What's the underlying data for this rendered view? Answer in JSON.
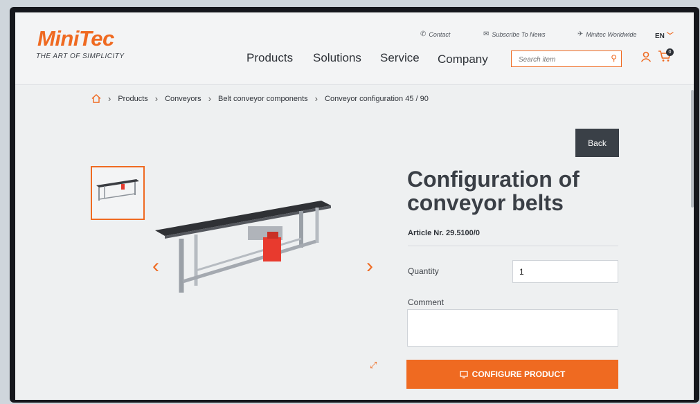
{
  "logo": {
    "name": "MiniTec",
    "tagline": "THE ART OF SIMPLICITY"
  },
  "topbar": {
    "contact": "Contact",
    "subscribe": "Subscribe To News",
    "worldwide": "Minitec Worldwide",
    "language": "EN"
  },
  "nav": [
    "Products",
    "Solutions",
    "Service",
    "Company"
  ],
  "search": {
    "placeholder": "Search item"
  },
  "cart": {
    "count": "0"
  },
  "breadcrumb": [
    "Products",
    "Conveyors",
    "Belt conveyor components",
    "Conveyor configuration 45 / 90"
  ],
  "product": {
    "back_label": "Back",
    "title": "Configuration of conveyor belts",
    "article": "Article Nr. 29.5100/0",
    "quantity_label": "Quantity",
    "quantity_value": "1",
    "comment_label": "Comment",
    "configure_label": "CONFIGURE PRODUCT"
  },
  "colors": {
    "accent": "#ef6a21",
    "dark": "#3a4047"
  },
  "icons": [
    "home-icon",
    "phone-icon",
    "mail-icon",
    "globe-icon",
    "search-icon",
    "user-icon",
    "cart-icon",
    "expand-icon",
    "monitor-icon"
  ]
}
